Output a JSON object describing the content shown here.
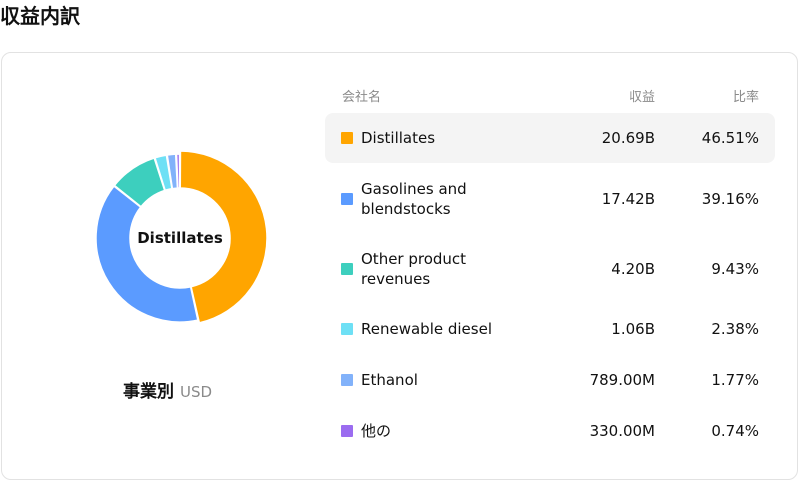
{
  "page": {
    "title": "収益内訳"
  },
  "table": {
    "headers": {
      "name": "会社名",
      "revenue": "収益",
      "ratio": "比率"
    },
    "rows": [
      {
        "name": "Distillates",
        "revenue": "20.69B",
        "ratio": "46.51%",
        "color": "#FFA500"
      },
      {
        "name": "Gasolines and blendstocks",
        "revenue": "17.42B",
        "ratio": "39.16%",
        "color": "#5B9BFF"
      },
      {
        "name": "Other product revenues",
        "revenue": "4.20B",
        "ratio": "9.43%",
        "color": "#3DCFBE"
      },
      {
        "name": "Renewable diesel",
        "revenue": "1.06B",
        "ratio": "2.38%",
        "color": "#6EE0F5"
      },
      {
        "name": "Ethanol",
        "revenue": "789.00M",
        "ratio": "1.77%",
        "color": "#82B2FA"
      },
      {
        "name": "他の",
        "revenue": "330.00M",
        "ratio": "0.74%",
        "color": "#9B6CF0"
      }
    ]
  },
  "chart_data": {
    "type": "pie",
    "center_label": "Distillates",
    "caption": "事業別",
    "unit": "USD",
    "categories": [
      "Distillates",
      "Gasolines and blendstocks",
      "Other product revenues",
      "Renewable diesel",
      "Ethanol",
      "他の"
    ],
    "values": [
      46.51,
      39.16,
      9.43,
      2.38,
      1.77,
      0.74
    ],
    "colors": [
      "#FFA500",
      "#5B9BFF",
      "#3DCFBE",
      "#6EE0F5",
      "#82B2FA",
      "#9B6CF0"
    ],
    "highlighted": "Distillates"
  }
}
